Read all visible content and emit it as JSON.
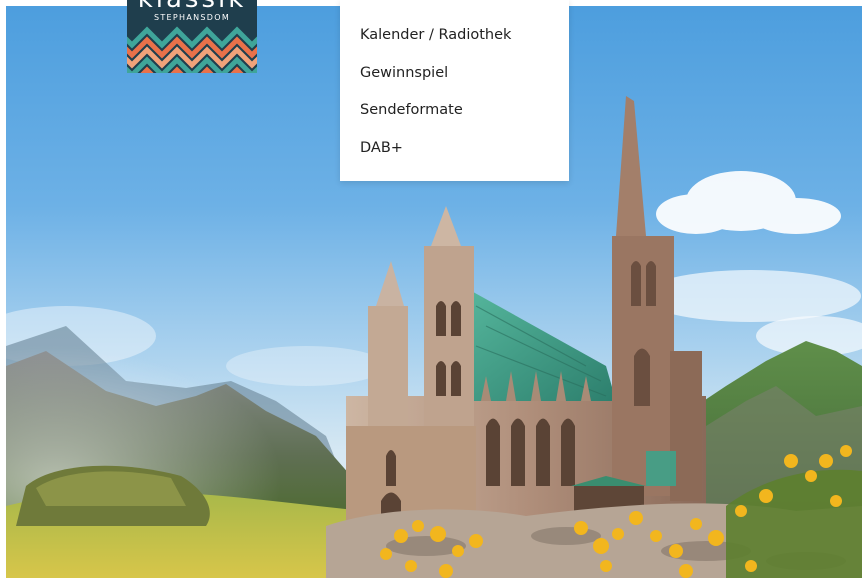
{
  "logo": {
    "wordmark": "klassik",
    "subtitle": "STEPHANSDOM"
  },
  "menu": {
    "items": [
      {
        "label": "Kalender / Radiothek"
      },
      {
        "label": "Gewinnspiel"
      },
      {
        "label": "Sendeformate"
      },
      {
        "label": "DAB+"
      }
    ]
  },
  "colors": {
    "sky": "#5aa8e2",
    "logo_bg": "#1f3e4d",
    "logo_orange": "#e8714a",
    "logo_teal": "#3fa59a",
    "roof_green": "#3aa58c",
    "flower_yellow": "#f2b61e",
    "menu_text": "#222222"
  }
}
